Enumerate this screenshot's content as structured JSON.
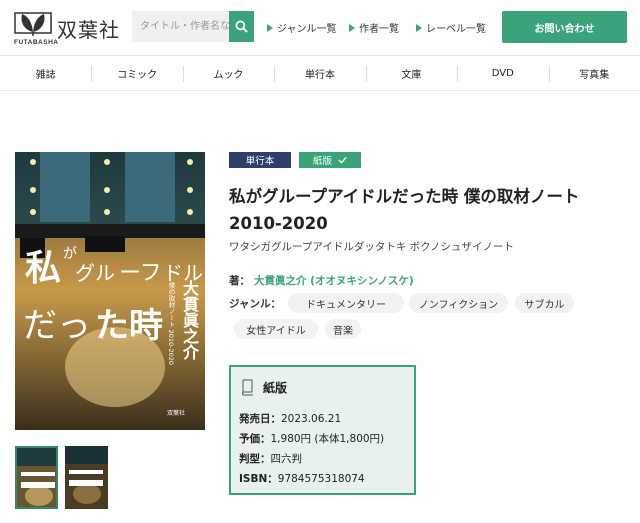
{
  "header": {
    "logo_name": "双葉社",
    "logo_sub": "FUTABASHA",
    "search_placeholder": "タイトル・作者名な",
    "nav": [
      "ジャンル一覧",
      "作者一覧",
      "レーベル一覧"
    ],
    "contact": "お問い合わせ",
    "brand_color": "#3aa37a"
  },
  "categories": [
    "雑誌",
    "コミック",
    "ムック",
    "単行本",
    "文庫",
    "DVD",
    "写真集"
  ],
  "book": {
    "badge_category": "単行本",
    "badge_format": "紙版",
    "title": "私がグループアイドルだった時 僕の取材ノート 2010-2020",
    "kana": "ワタシガグループアイドルダッタトキ ボクノシュザイノート",
    "author_label": "著：",
    "author_name": "大貫眞之介 (オオヌキシンノスケ)",
    "genre_label": "ジャンル：",
    "genres": [
      "ドキュメンタリー",
      "ノンフィクション",
      "サブカル",
      "女性アイドル",
      "音楽"
    ],
    "cover_title": "私がグループアイドルだった時",
    "cover_author": "大貫眞之介",
    "cover_subtitle": "僕の取材ノート 2010-2020",
    "cover_publisher": "双葉社"
  },
  "format": {
    "title": "紙版",
    "icon": "book-icon",
    "release_label": "発売日：",
    "release": "2023.06.21",
    "price_label": "予価：",
    "price": "1,980円 (本体1,800円)",
    "size_label": "判型：",
    "size": "四六判",
    "isbn_label": "ISBN：",
    "isbn": "9784575318074"
  }
}
